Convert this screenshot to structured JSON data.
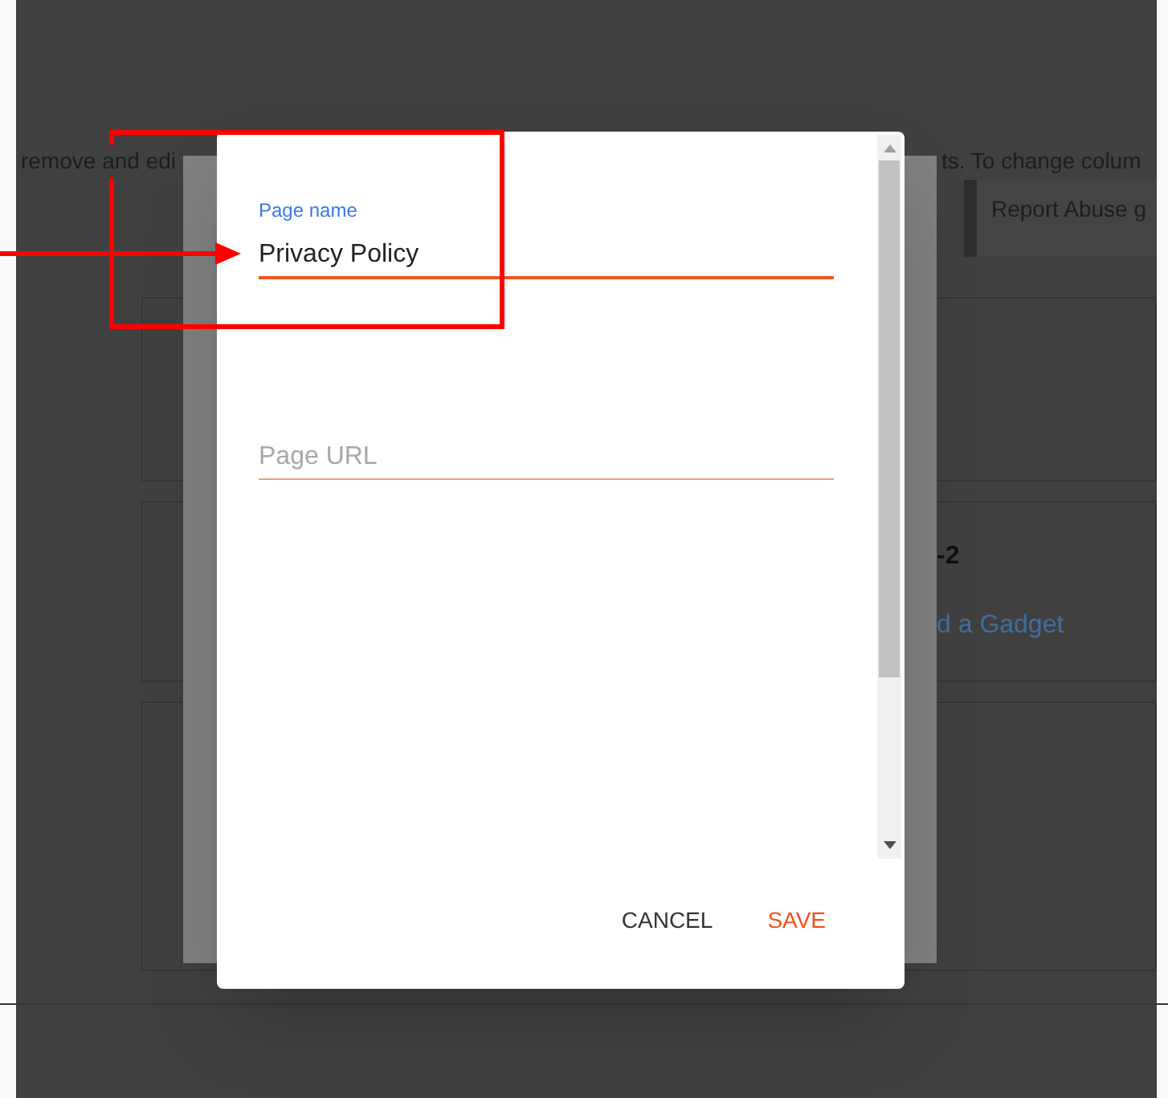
{
  "background_page": {
    "instructions_left": "remove and edi",
    "instructions_right": "ts. To change colum",
    "gadget_title": "Report Abuse g",
    "column_heading": "-2",
    "add_gadget_link": "d a Gadget"
  },
  "dialog": {
    "fields": [
      {
        "label": "Page name",
        "value": "Privacy Policy",
        "focused": true
      },
      {
        "placeholder": "Page URL",
        "focused": false
      }
    ],
    "buttons": [
      {
        "label": "CANCEL",
        "kind": "secondary"
      },
      {
        "label": "SAVE",
        "kind": "primary"
      }
    ]
  }
}
